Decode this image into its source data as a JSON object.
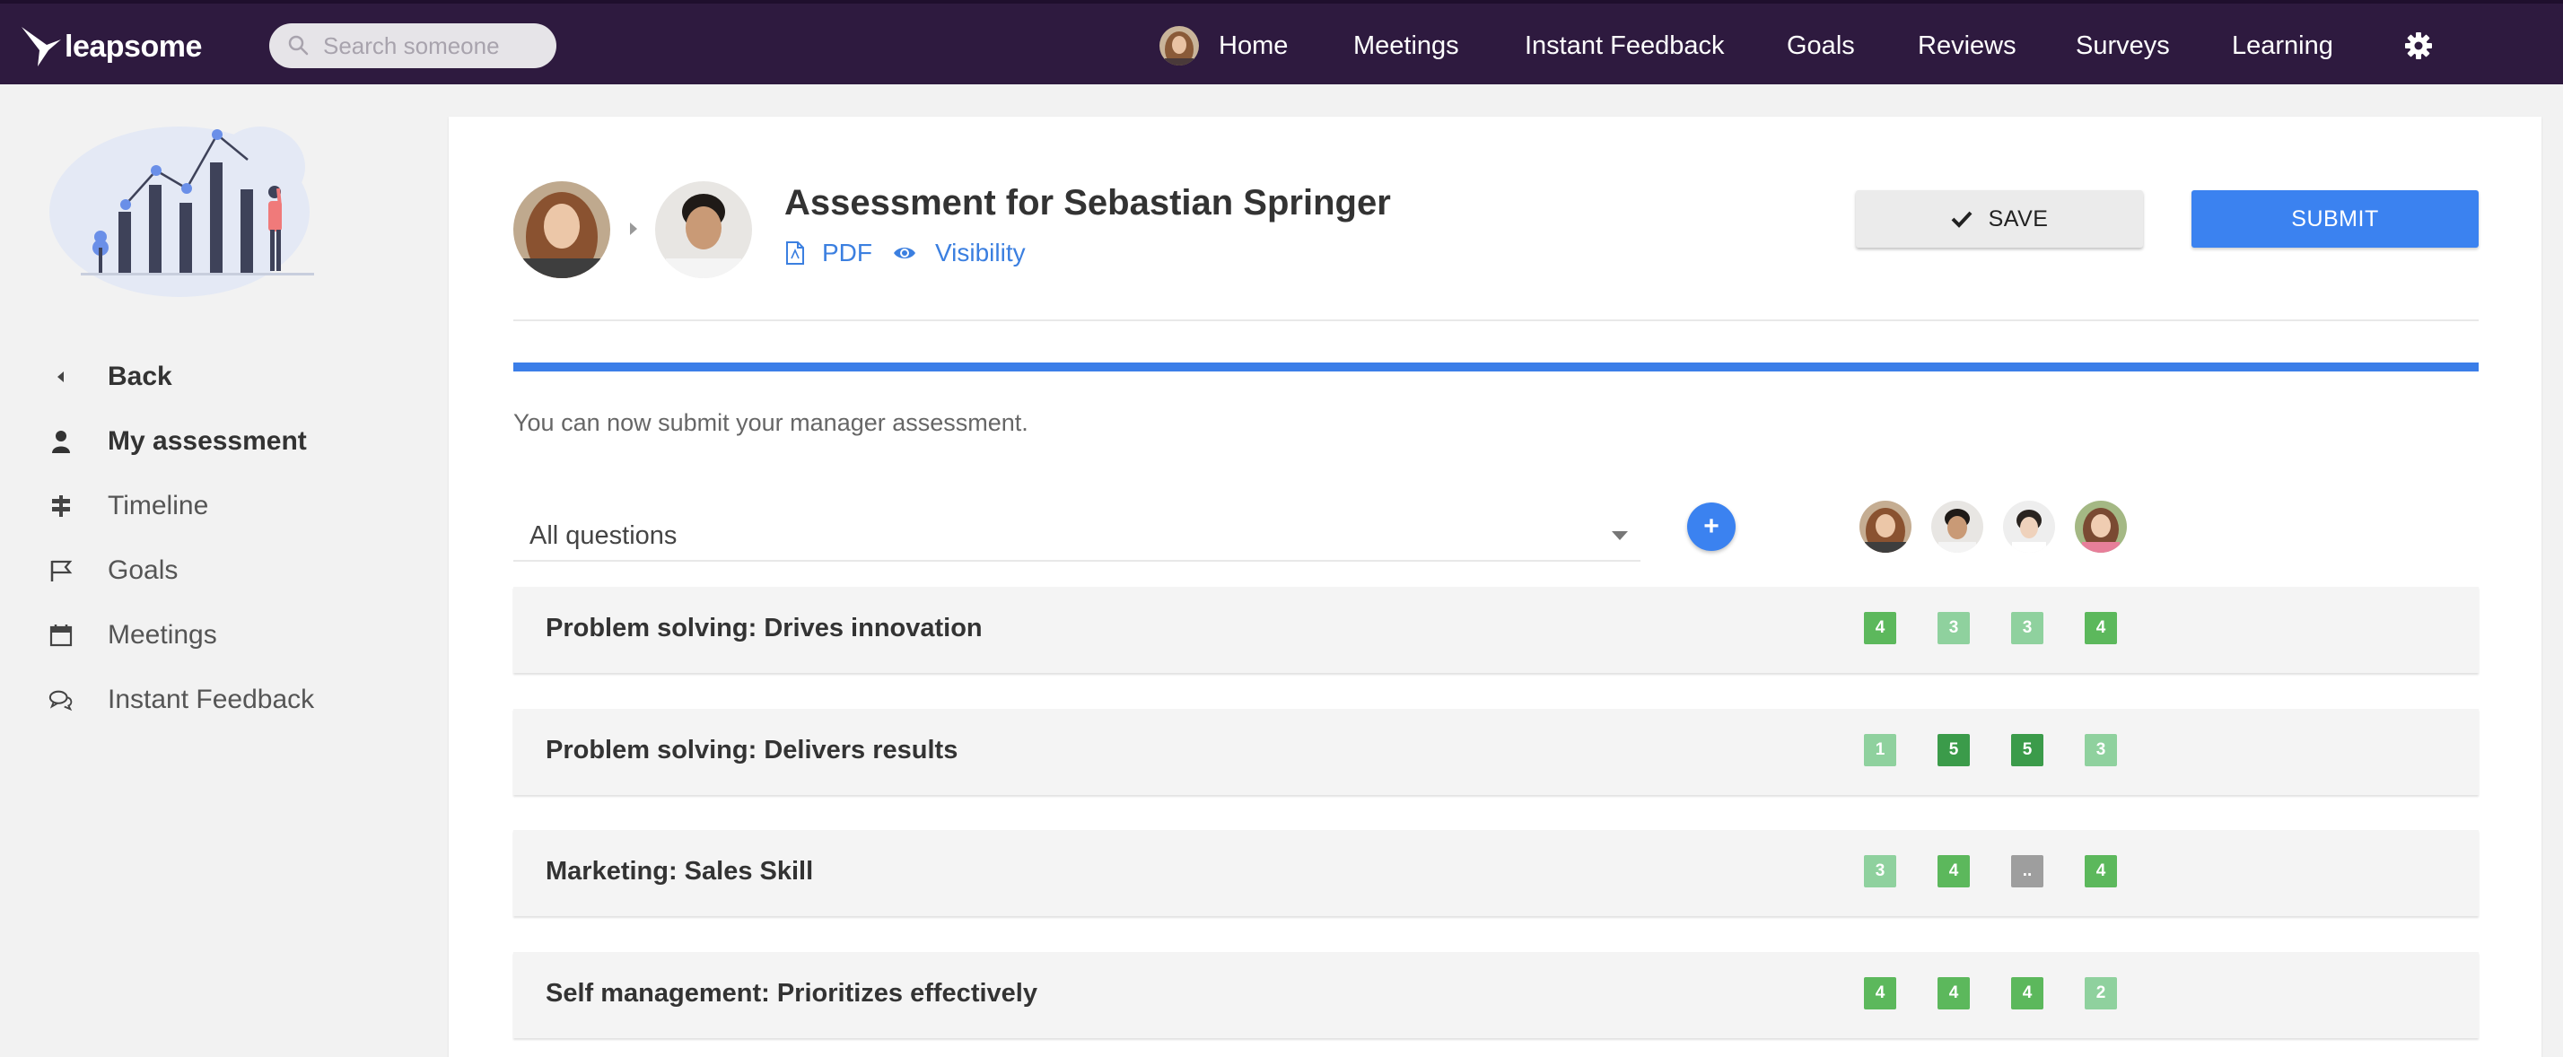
{
  "app": {
    "name": "leapsome"
  },
  "search": {
    "placeholder": "Search someone"
  },
  "nav": {
    "items": [
      "Home",
      "Meetings",
      "Instant Feedback",
      "Goals",
      "Reviews",
      "Surveys",
      "Learning"
    ]
  },
  "sidebar": {
    "items": [
      "Back",
      "My assessment",
      "Timeline",
      "Goals",
      "Meetings",
      "Instant Feedback"
    ]
  },
  "assessment": {
    "title": "Assessment for Sebastian Springer",
    "pdf_label": "PDF",
    "visibility_label": "Visibility",
    "save_label": "SAVE",
    "submit_label": "SUBMIT",
    "progress_percent": 100,
    "info_text": "You can now submit your manager assessment."
  },
  "filter": {
    "selected": "All questions",
    "add_label": "+"
  },
  "colors": {
    "topbar": "#2e1a3f",
    "accent": "#3b82f0",
    "score_strong": "#3b9b4a",
    "score_mid": "#5cb85c",
    "score_light": "#8fd19e",
    "score_pending": "#9e9e9e"
  },
  "questions": [
    {
      "label": "Problem solving: Drives innovation",
      "scores": [
        "4",
        "3",
        "3",
        "4"
      ]
    },
    {
      "label": "Problem solving: Delivers results",
      "scores": [
        "1",
        "5",
        "5",
        "3"
      ]
    },
    {
      "label": "Marketing: Sales Skill",
      "scores": [
        "3",
        "4",
        "..",
        "4"
      ]
    },
    {
      "label": "Self management: Prioritizes effectively",
      "scores": [
        "4",
        "4",
        "4",
        "2"
      ]
    }
  ]
}
